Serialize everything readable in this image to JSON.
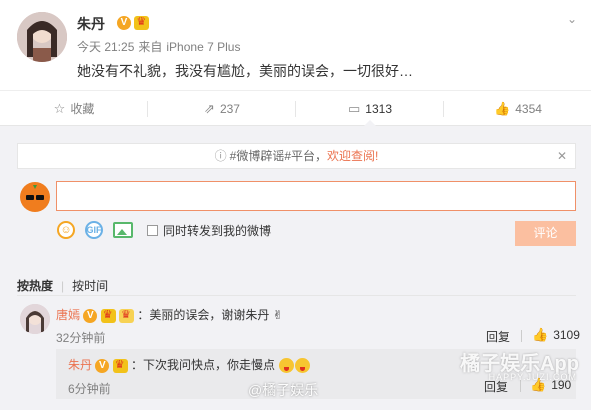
{
  "post": {
    "author": "朱丹",
    "time": "今天 21:25",
    "source_prefix": "来自",
    "source": "iPhone 7 Plus",
    "text": "她没有不礼貌，我没有尴尬，美丽的误会，一切很好…"
  },
  "actions": [
    {
      "icon": "star-icon",
      "label": "收藏"
    },
    {
      "icon": "share-icon",
      "label": "237"
    },
    {
      "icon": "comment-icon",
      "label": "1313"
    },
    {
      "icon": "like-icon",
      "label": "4354"
    }
  ],
  "comments_panel": {
    "notice_text": "#微博辟谣#平台，",
    "notice_link": "欢迎查阅!",
    "input_value": "",
    "input_placeholder": "",
    "forward_label": "同时转发到我的微博",
    "submit_label": "评论",
    "sort_hot": "按热度",
    "sort_time": "按时间"
  },
  "comments": [
    {
      "user": "唐嫣",
      "text": "：美丽的误会，谢谢朱丹",
      "time": "32分钟前",
      "reply_label": "回复",
      "likes": "3109",
      "replies": [
        {
          "user": "朱丹",
          "text": "：下次我问快点，你走慢点",
          "time": "6分钟前",
          "reply_label": "回复",
          "likes": "190"
        }
      ]
    }
  ],
  "watermark": {
    "main": "橘子娱乐App",
    "sub": "HAPPY.JUZI.COM",
    "weibo": "@橘子娱乐"
  },
  "colors": {
    "accent": "#eb7350",
    "panel_bg": "#f2f2f5",
    "submit_disabled": "#fbbfa0"
  }
}
